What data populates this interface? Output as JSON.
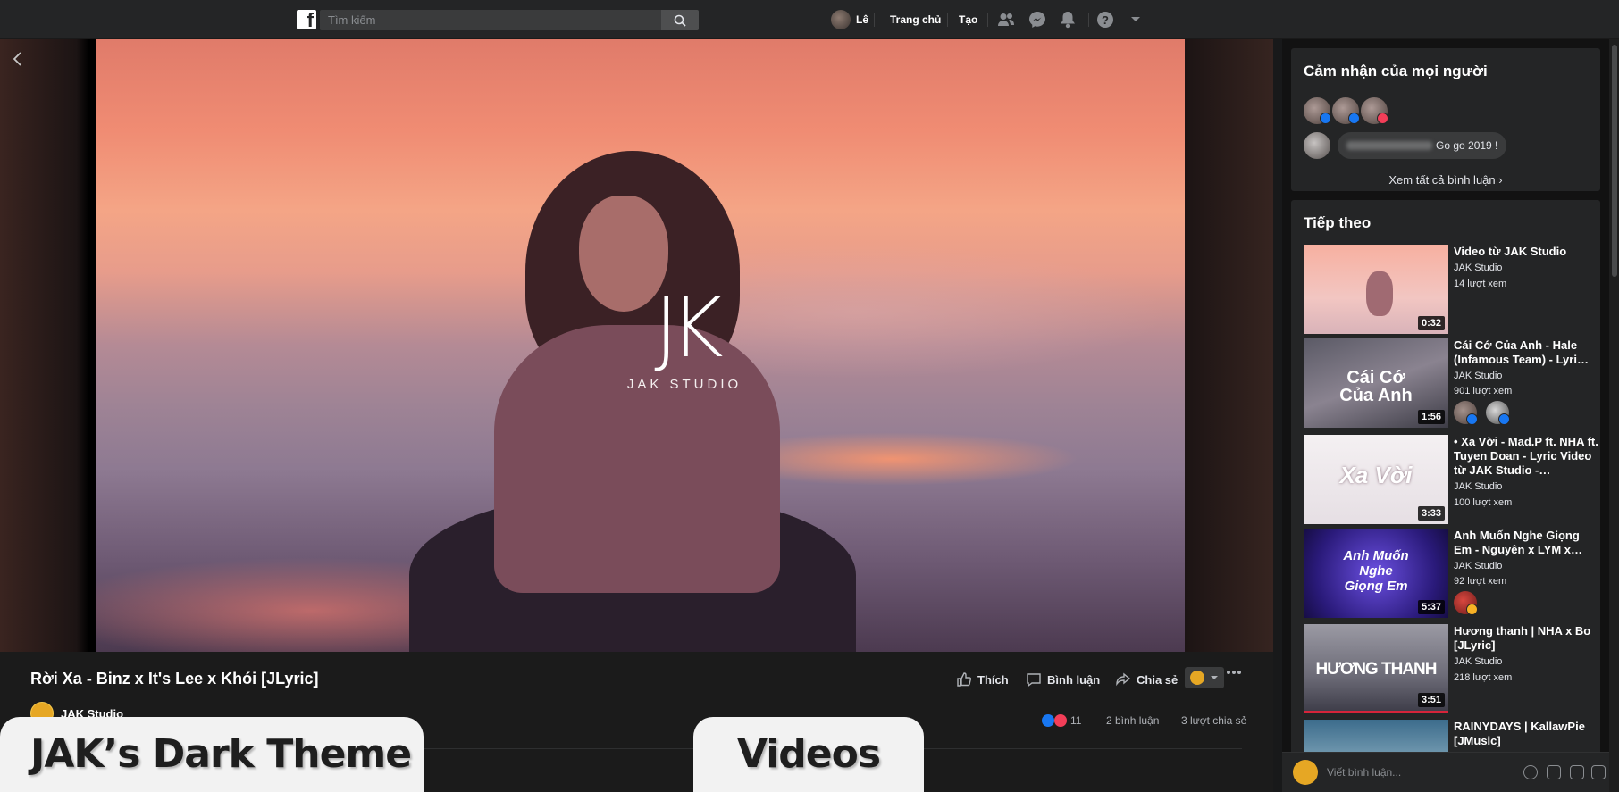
{
  "topbar": {
    "search_placeholder": "Tìm kiếm",
    "user_name": "Lê",
    "home_label": "Trang chủ",
    "create_label": "Tạo"
  },
  "video": {
    "watermark_title": "JAK STUDIO",
    "title": "Rời Xa - Binz x It's Lee x Khói [JLyric]",
    "page_name": "JAK Studio",
    "like_label": "Thích",
    "comment_label": "Bình luận",
    "share_label": "Chia sẻ",
    "reaction_count": "11",
    "comment_count": "2 bình luận",
    "share_count": "3 lượt chia sẻ"
  },
  "reactions_card": {
    "title": "Cảm nhận của mọi người",
    "comment_text": "Go go 2019 !",
    "see_all": "Xem tất cả bình luận"
  },
  "up_next": {
    "title": "Tiếp theo",
    "items": [
      {
        "title": "Video từ JAK Studio",
        "channel": "JAK Studio",
        "views": "14 lượt xem",
        "duration": "0:32",
        "thumb_text": ""
      },
      {
        "title": "Cái Cớ Của Anh - Hale (Infamous Team) - Lyri…",
        "channel": "JAK Studio",
        "views": "901 lượt xem",
        "duration": "1:56",
        "thumb_text": "Cái Cớ Của Anh"
      },
      {
        "title": "• Xa Vời - Mad.P ft. NHA ft. Tuyen Doan - Lyric Video từ JAK Studio -…",
        "channel": "JAK Studio",
        "views": "100 lượt xem",
        "duration": "3:33",
        "thumb_text": "Xa Vời"
      },
      {
        "title": "Anh Muốn Nghe Giọng Em - Nguyên x LYM x…",
        "channel": "JAK Studio",
        "views": "92 lượt xem",
        "duration": "5:37",
        "thumb_text": "Anh Muốn Nghe Giọng Em"
      },
      {
        "title": "Hương thanh | NHA x Bo [JLyric]",
        "channel": "JAK Studio",
        "views": "218 lượt xem",
        "duration": "3:51",
        "thumb_text": "HƯƠNG THANH"
      },
      {
        "title": "RAINYDAYS | KallawPie [JMusic]",
        "channel": "",
        "views": "",
        "duration": "",
        "thumb_text": ""
      }
    ]
  },
  "comment_bar": {
    "placeholder": "Viết bình luận..."
  },
  "banners": {
    "left": "JAK’s Dark Theme",
    "right": "Videos"
  },
  "colors": {
    "like_blue": "#1877f2",
    "love_red": "#f33e58",
    "dark_bg": "#18191a",
    "card_bg": "#242526"
  }
}
